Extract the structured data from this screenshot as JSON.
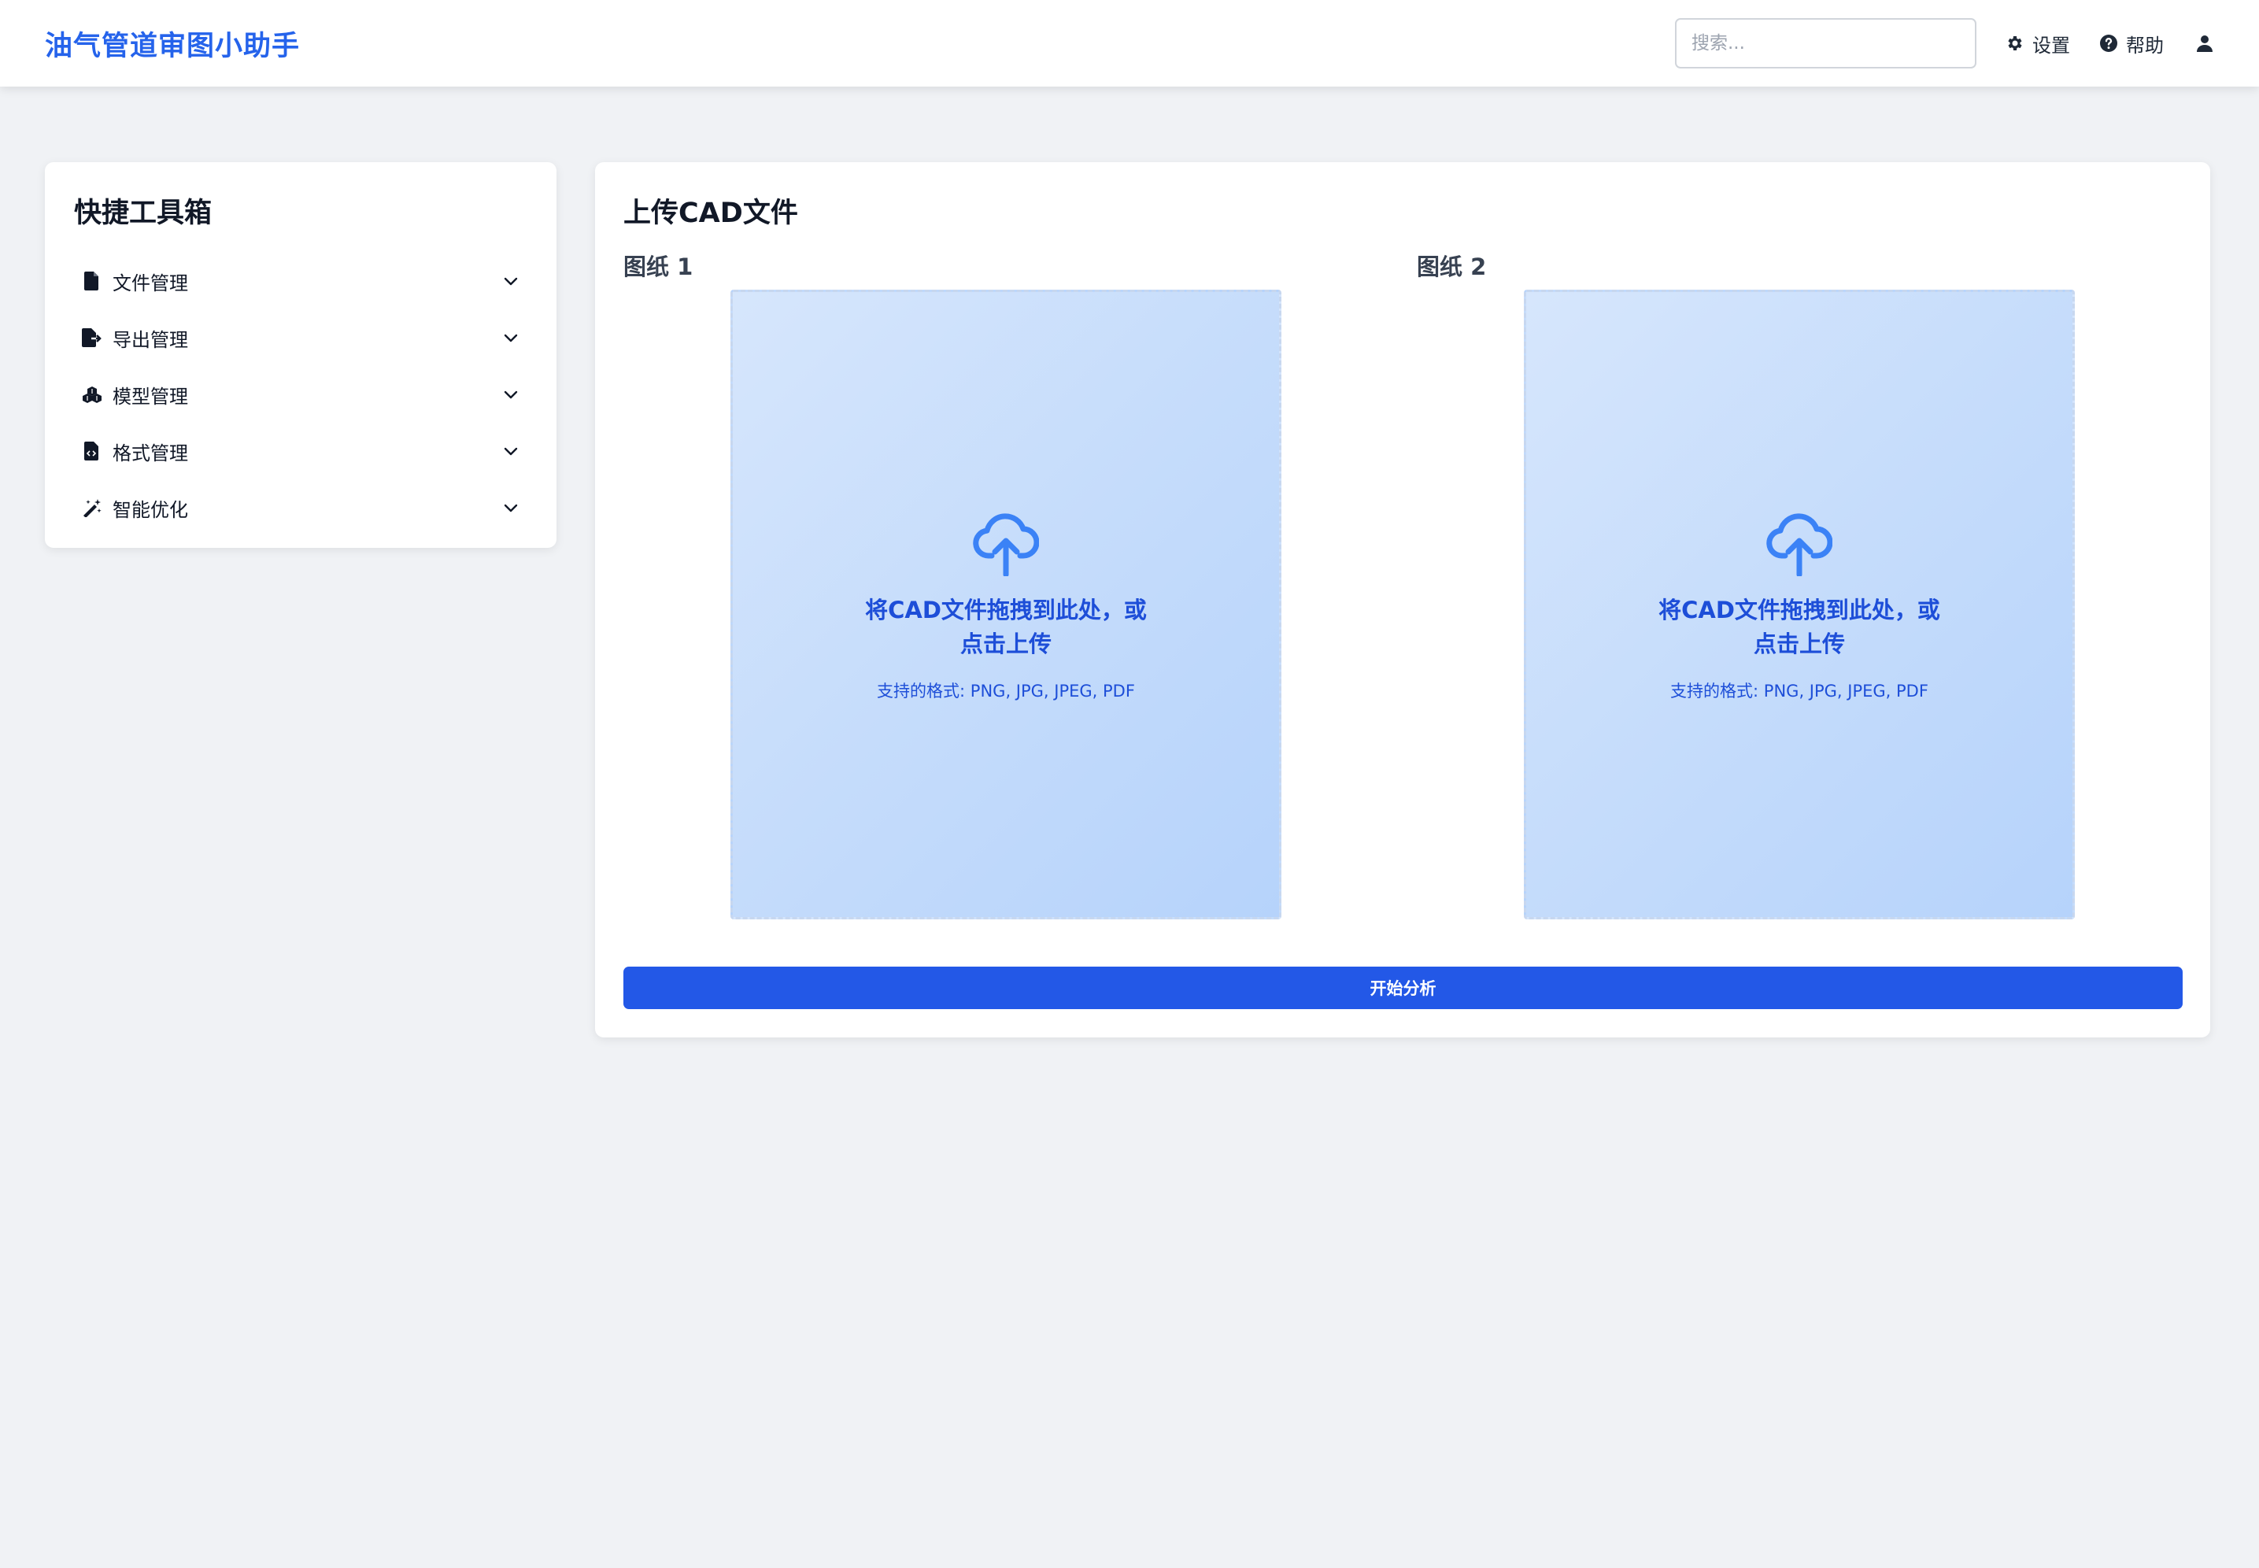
{
  "header": {
    "app_title": "油气管道审图小助手",
    "search_placeholder": "搜索...",
    "settings_label": "设置",
    "help_label": "帮助"
  },
  "sidebar": {
    "title": "快捷工具箱",
    "items": [
      {
        "label": "文件管理",
        "icon": "file-icon"
      },
      {
        "label": "导出管理",
        "icon": "file-export-icon"
      },
      {
        "label": "模型管理",
        "icon": "cubes-icon"
      },
      {
        "label": "格式管理",
        "icon": "file-code-icon"
      },
      {
        "label": "智能优化",
        "icon": "magic-wand-icon"
      }
    ]
  },
  "main": {
    "title": "上传CAD文件",
    "drawings": [
      {
        "label": "图纸 1",
        "drop_text": "将CAD文件拖拽到此处，或点击上传",
        "formats_text": "支持的格式: PNG, JPG, JPEG, PDF"
      },
      {
        "label": "图纸 2",
        "drop_text": "将CAD文件拖拽到此处，或点击上传",
        "formats_text": "支持的格式: PNG, JPG, JPEG, PDF"
      }
    ],
    "analyze_button": "开始分析"
  },
  "colors": {
    "brand": "#2563eb",
    "button": "#2358e7",
    "background": "#f0f2f5",
    "dropzone_text": "#1d4ed8"
  }
}
